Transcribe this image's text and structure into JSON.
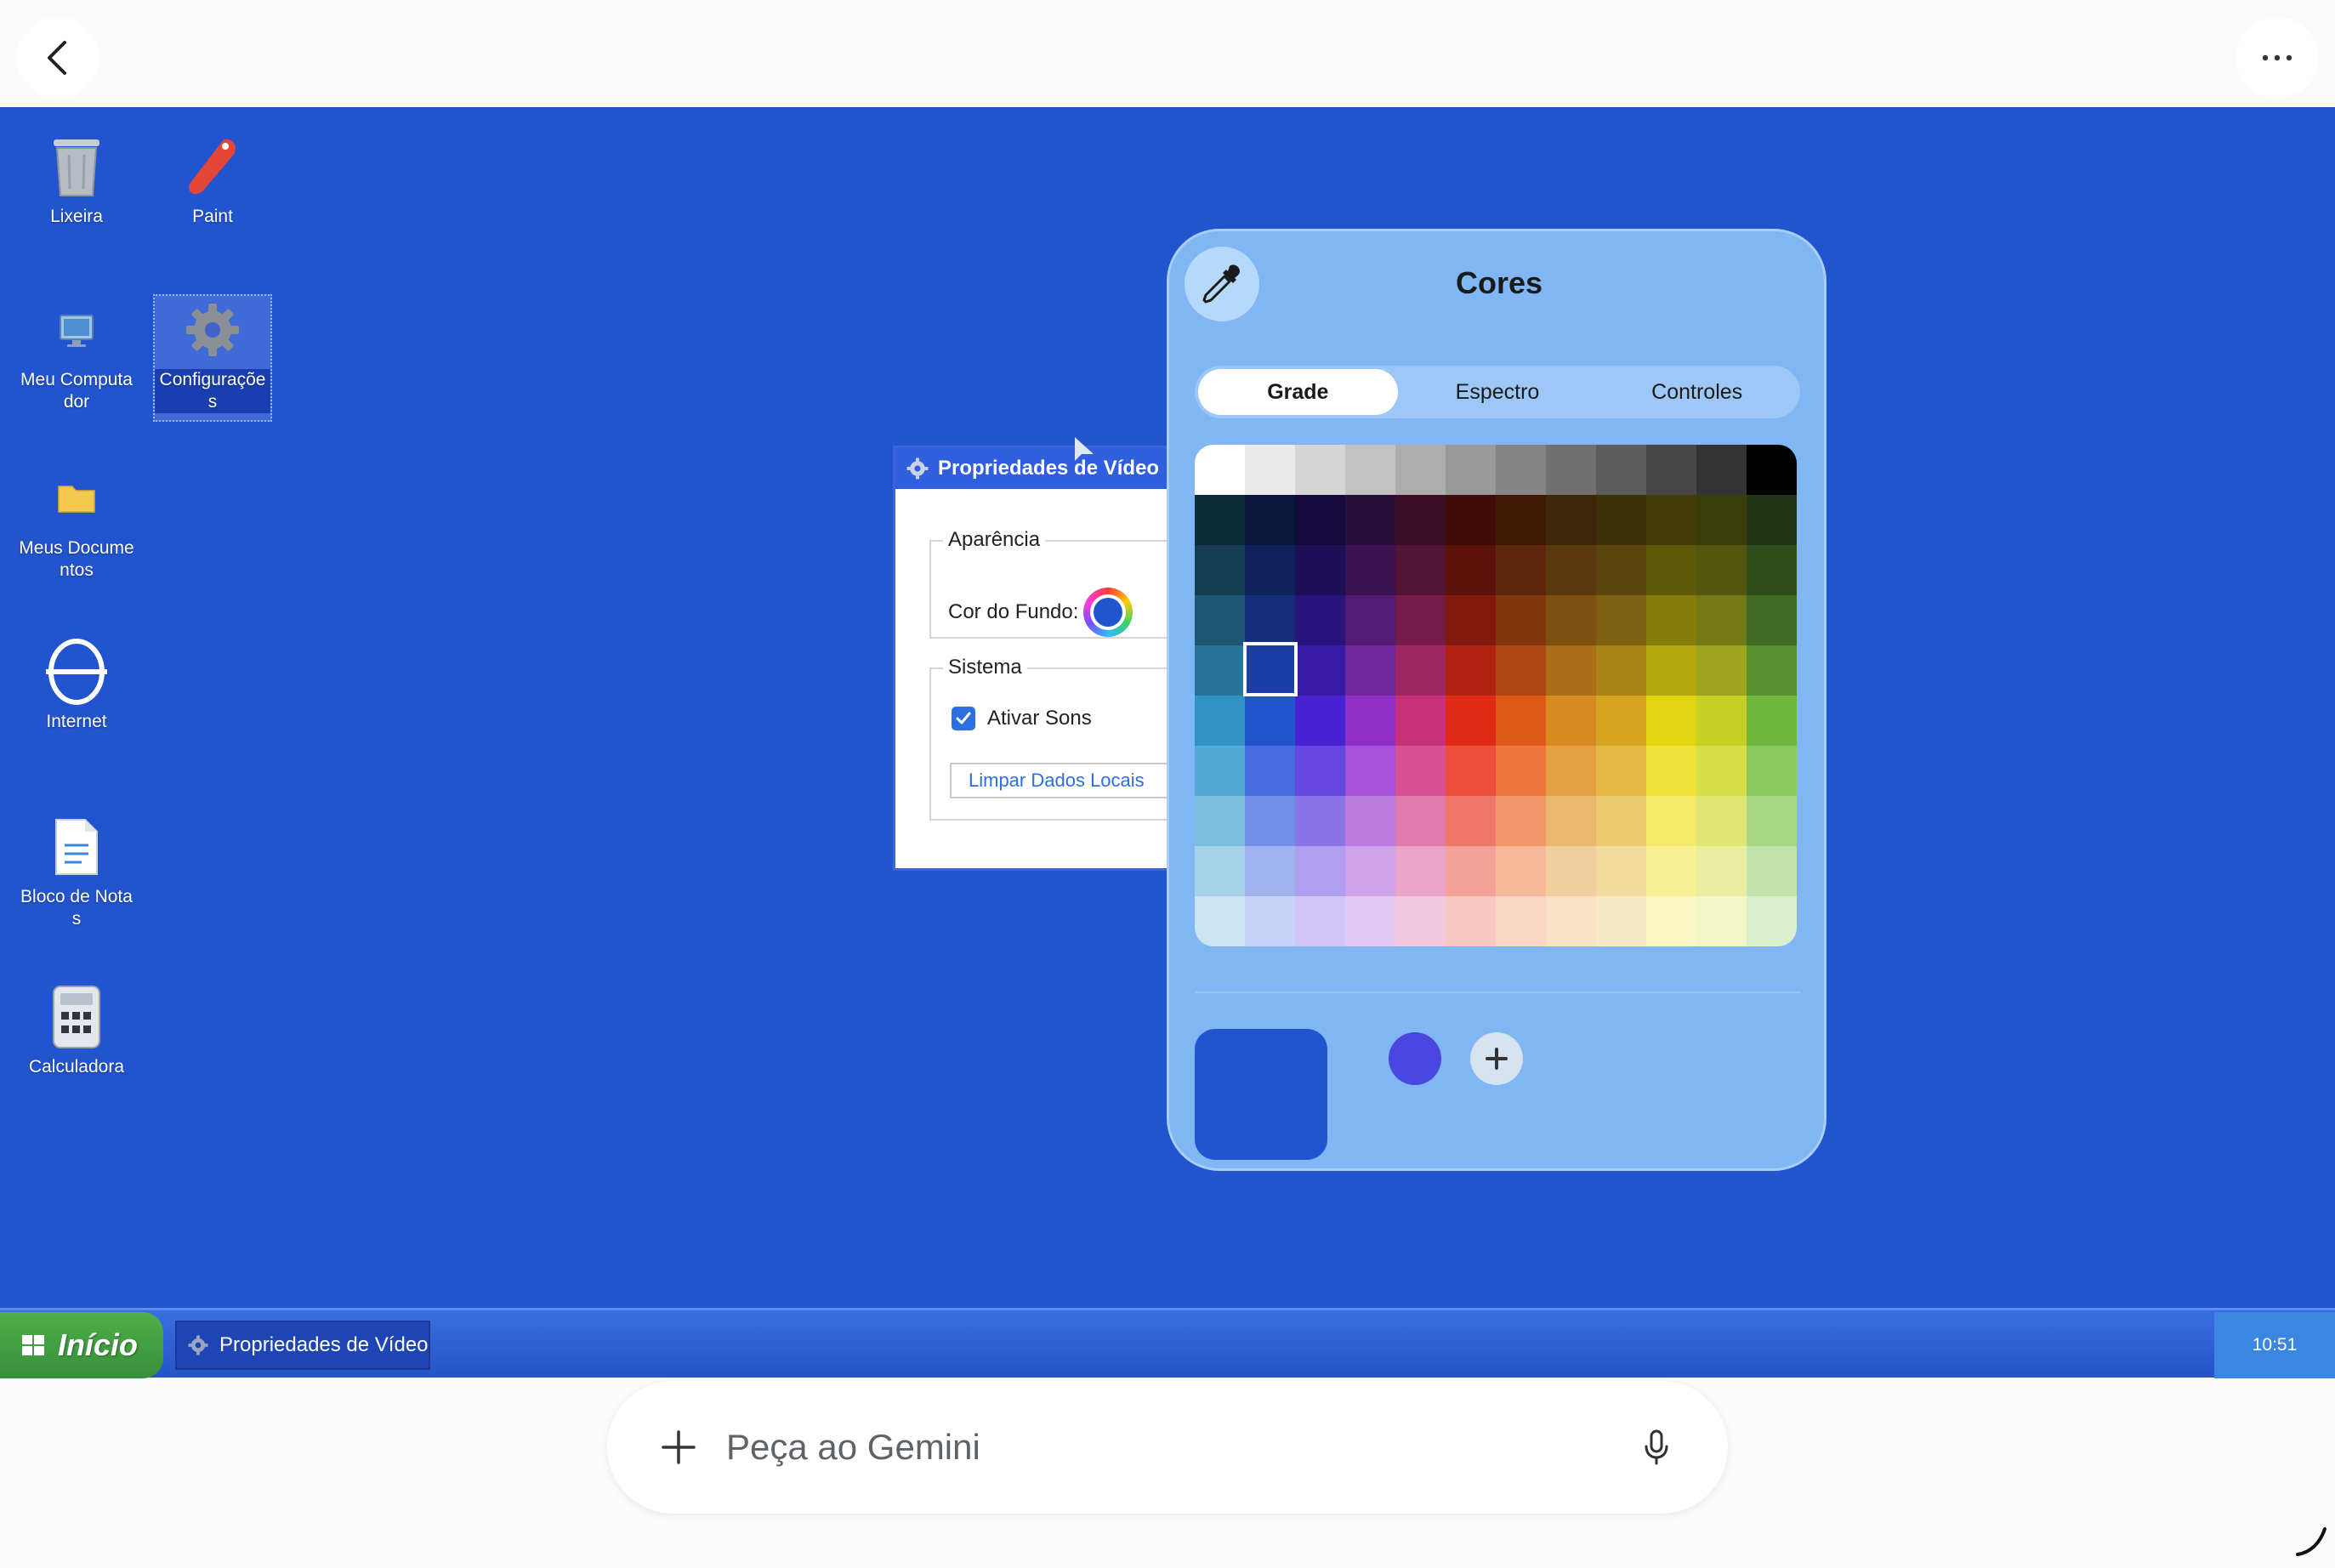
{
  "desktop": {
    "icons": [
      {
        "label": "Lixeira",
        "icon": "trash-icon"
      },
      {
        "label": "Paint",
        "icon": "paint-icon"
      },
      {
        "label": "Meu Computador",
        "icon": "computer-icon"
      },
      {
        "label": "Configurações",
        "icon": "gear-icon"
      },
      {
        "label": "Meus Documentos",
        "icon": "folder-icon"
      },
      {
        "label": "Internet",
        "icon": "internet-icon"
      },
      {
        "label": "Bloco de Notas",
        "icon": "notepad-icon"
      },
      {
        "label": "Calculadora",
        "icon": "calculator-icon"
      }
    ],
    "background_color": "#2254cf"
  },
  "video_window": {
    "title": "Propriedades de Vídeo",
    "appearance_legend": "Aparência",
    "bg_color_label": "Cor do Fundo:",
    "system_legend": "Sistema",
    "sounds_label": "Ativar Sons",
    "sounds_checked": true,
    "clear_button": "Limpar Dados Locais"
  },
  "color_panel": {
    "title": "Cores",
    "tabs": [
      "Grade",
      "Espectro",
      "Controles"
    ],
    "active_tab": "Grade",
    "selected_color": "#2254cf",
    "saved_color": "#4a46e0"
  },
  "taskbar": {
    "start_label": "Início",
    "task_label": "Propriedades de Vídeo",
    "clock": "10:51"
  },
  "gemini": {
    "placeholder": "Peça ao Gemini"
  }
}
